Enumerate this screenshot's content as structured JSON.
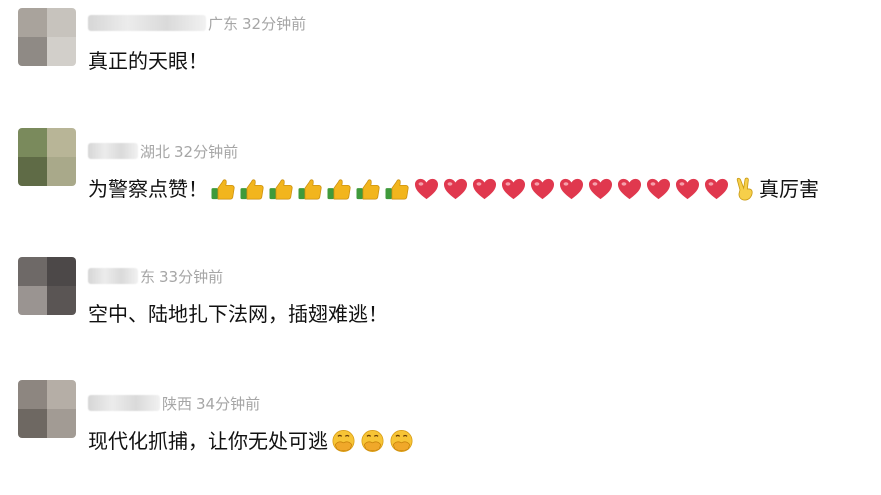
{
  "comments": [
    {
      "region": "广东",
      "time": "32分钟前",
      "text": "真正的天眼！",
      "emojis": [],
      "avatar_colors": [
        "#a9a39c",
        "#c7c3bd",
        "#8f8a85",
        "#d2cfca"
      ],
      "name_visible_tail": "广东"
    },
    {
      "region": "湖北",
      "time": "32分钟前",
      "text": "为警察点赞！",
      "emojis": [
        "thumbs-up-icon",
        "thumbs-up-icon",
        "thumbs-up-icon",
        "thumbs-up-icon",
        "thumbs-up-icon",
        "thumbs-up-icon",
        "thumbs-up-icon",
        "heart-icon",
        "heart-icon",
        "heart-icon",
        "heart-icon",
        "heart-icon",
        "heart-icon",
        "heart-icon",
        "heart-icon",
        "heart-icon",
        "heart-icon",
        "heart-icon",
        "victory-hand-icon"
      ],
      "text_after": "真厉害",
      "avatar_colors": [
        "#7a8a5c",
        "#b8b597",
        "#5f6b46",
        "#a9a98a"
      ]
    },
    {
      "region": "东",
      "time": "33分钟前",
      "text": "空中、陆地扎下法网，插翅难逃！",
      "emojis": [],
      "avatar_colors": [
        "#6e6967",
        "#4c4848",
        "#9a9491",
        "#5a5554"
      ]
    },
    {
      "region": "陕西",
      "time": "34分钟前",
      "text": "现代化抓捕，让你无处可逃",
      "emojis": [
        "facepalm-icon",
        "facepalm-icon",
        "facepalm-icon"
      ],
      "avatar_colors": [
        "#8d8680",
        "#b5aea6",
        "#6e6862",
        "#a29b94"
      ]
    }
  ],
  "colors": {
    "meta_text": "#a6a6a6",
    "comment_text": "#111111",
    "heart": "#e0384e",
    "thumb": "#f2b51d",
    "cuff": "#3f9a3b"
  }
}
